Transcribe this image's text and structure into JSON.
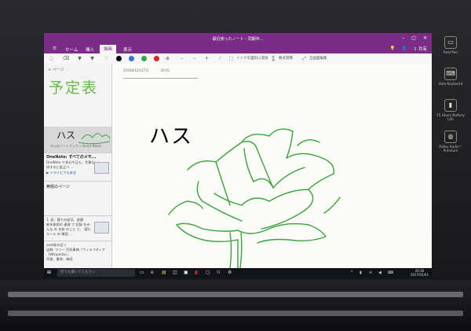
{
  "window": {
    "title": "最近使ったノート - 同期中..."
  },
  "tabs": [
    {
      "label": "ホーム"
    },
    {
      "label": "挿入"
    },
    {
      "label": "描画",
      "active": true
    },
    {
      "label": "表示"
    }
  ],
  "ribbon_right": {
    "share_label": "共有"
  },
  "toolbar": {
    "pen_colors": [
      "#000000",
      "#3a6fd8",
      "#2fa84a",
      "#e02222"
    ],
    "ink_to_text": "インクを図形に変換",
    "ink_to_math": "数式演算",
    "full_screen": "全画面編集"
  },
  "sidebar": {
    "add_page": "+ ページ",
    "section_title": "予定表",
    "pages": [
      {
        "hand": "ハス",
        "sub": "のんのノートブック » Quick Notes"
      },
      {
        "title": "OneNote: すべてのメモ...",
        "lines": [
          "OneNote で多分今日も、大事な",
          "探すのに役立つ ...",
          "▶ ドライビでも安全"
        ]
      },
      {
        "title": "無題のページ",
        "lines": []
      },
      {
        "title": "",
        "lines": [
          "1. 画 : 寝ての部活、放課",
          "新年挨拶の 連絡 で 記録 をみ",
          "んな の 名前 のこと と、 寝た",
          "ルール の 確認 ..."
        ]
      },
      {
        "title": "",
        "lines": [
          "ooの駅の近く",
          "出典: フリー 百科事典『ウィキペディア",
          "（Wikipedia）』",
          "早稲、夏休、梅雨"
        ]
      }
    ]
  },
  "canvas": {
    "date": "2016年12月27日",
    "time": "20:01",
    "handwriting": "ハス"
  },
  "taskbar": {
    "search_placeholder": "何でも聞いてください",
    "time": "20:36",
    "date": "2017/01/01"
  },
  "right_keys": [
    {
      "icon": "▭",
      "label": "Real Pen"
    },
    {
      "icon": "⌨",
      "label": "Halo Keyboard"
    },
    {
      "icon": "▮",
      "label": "15 Hours Battery Life"
    },
    {
      "icon": "◍",
      "label": "Dolby Audio™ Premium"
    }
  ]
}
